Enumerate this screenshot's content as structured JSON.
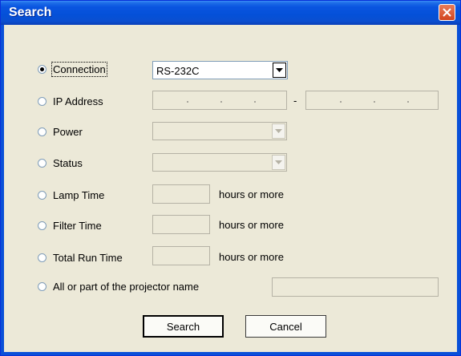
{
  "window": {
    "title": "Search",
    "close_icon": "close-icon"
  },
  "options": {
    "connection": "Connection",
    "ip_address": "IP Address",
    "power": "Power",
    "status": "Status",
    "lamp_time": "Lamp Time",
    "filter_time": "Filter Time",
    "total_run_time": "Total Run Time",
    "projector_name": "All or part of the projector name"
  },
  "connection_select": {
    "value": "RS-232C"
  },
  "ip_separator": "-",
  "units": {
    "lamp": "hours or more",
    "filter": "hours or more",
    "total": "hours or more"
  },
  "buttons": {
    "search": "Search",
    "cancel": "Cancel"
  },
  "colors": {
    "titlebar": "#0a55e0",
    "dialog_bg": "#ece9d8",
    "close_button": "#d2451e"
  }
}
